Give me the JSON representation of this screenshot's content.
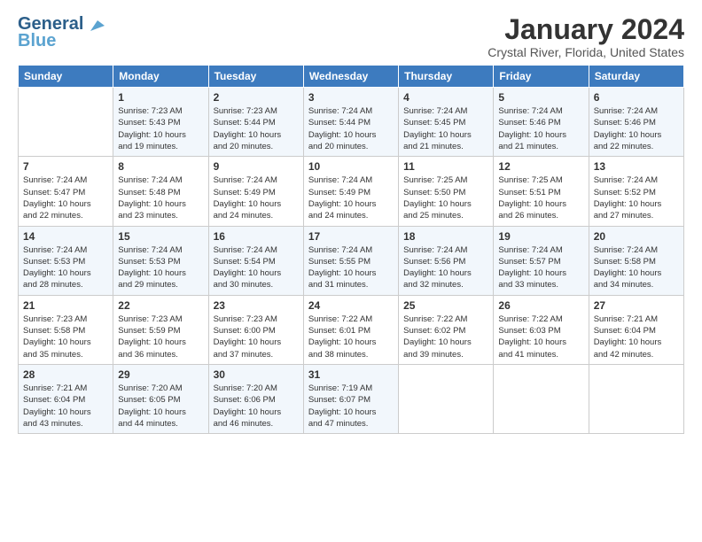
{
  "logo": {
    "line1": "General",
    "line2": "Blue"
  },
  "title": "January 2024",
  "location": "Crystal River, Florida, United States",
  "days_of_week": [
    "Sunday",
    "Monday",
    "Tuesday",
    "Wednesday",
    "Thursday",
    "Friday",
    "Saturday"
  ],
  "weeks": [
    [
      {
        "num": "",
        "detail": ""
      },
      {
        "num": "1",
        "detail": "Sunrise: 7:23 AM\nSunset: 5:43 PM\nDaylight: 10 hours\nand 19 minutes."
      },
      {
        "num": "2",
        "detail": "Sunrise: 7:23 AM\nSunset: 5:44 PM\nDaylight: 10 hours\nand 20 minutes."
      },
      {
        "num": "3",
        "detail": "Sunrise: 7:24 AM\nSunset: 5:44 PM\nDaylight: 10 hours\nand 20 minutes."
      },
      {
        "num": "4",
        "detail": "Sunrise: 7:24 AM\nSunset: 5:45 PM\nDaylight: 10 hours\nand 21 minutes."
      },
      {
        "num": "5",
        "detail": "Sunrise: 7:24 AM\nSunset: 5:46 PM\nDaylight: 10 hours\nand 21 minutes."
      },
      {
        "num": "6",
        "detail": "Sunrise: 7:24 AM\nSunset: 5:46 PM\nDaylight: 10 hours\nand 22 minutes."
      }
    ],
    [
      {
        "num": "7",
        "detail": "Sunrise: 7:24 AM\nSunset: 5:47 PM\nDaylight: 10 hours\nand 22 minutes."
      },
      {
        "num": "8",
        "detail": "Sunrise: 7:24 AM\nSunset: 5:48 PM\nDaylight: 10 hours\nand 23 minutes."
      },
      {
        "num": "9",
        "detail": "Sunrise: 7:24 AM\nSunset: 5:49 PM\nDaylight: 10 hours\nand 24 minutes."
      },
      {
        "num": "10",
        "detail": "Sunrise: 7:24 AM\nSunset: 5:49 PM\nDaylight: 10 hours\nand 24 minutes."
      },
      {
        "num": "11",
        "detail": "Sunrise: 7:25 AM\nSunset: 5:50 PM\nDaylight: 10 hours\nand 25 minutes."
      },
      {
        "num": "12",
        "detail": "Sunrise: 7:25 AM\nSunset: 5:51 PM\nDaylight: 10 hours\nand 26 minutes."
      },
      {
        "num": "13",
        "detail": "Sunrise: 7:24 AM\nSunset: 5:52 PM\nDaylight: 10 hours\nand 27 minutes."
      }
    ],
    [
      {
        "num": "14",
        "detail": "Sunrise: 7:24 AM\nSunset: 5:53 PM\nDaylight: 10 hours\nand 28 minutes."
      },
      {
        "num": "15",
        "detail": "Sunrise: 7:24 AM\nSunset: 5:53 PM\nDaylight: 10 hours\nand 29 minutes."
      },
      {
        "num": "16",
        "detail": "Sunrise: 7:24 AM\nSunset: 5:54 PM\nDaylight: 10 hours\nand 30 minutes."
      },
      {
        "num": "17",
        "detail": "Sunrise: 7:24 AM\nSunset: 5:55 PM\nDaylight: 10 hours\nand 31 minutes."
      },
      {
        "num": "18",
        "detail": "Sunrise: 7:24 AM\nSunset: 5:56 PM\nDaylight: 10 hours\nand 32 minutes."
      },
      {
        "num": "19",
        "detail": "Sunrise: 7:24 AM\nSunset: 5:57 PM\nDaylight: 10 hours\nand 33 minutes."
      },
      {
        "num": "20",
        "detail": "Sunrise: 7:24 AM\nSunset: 5:58 PM\nDaylight: 10 hours\nand 34 minutes."
      }
    ],
    [
      {
        "num": "21",
        "detail": "Sunrise: 7:23 AM\nSunset: 5:58 PM\nDaylight: 10 hours\nand 35 minutes."
      },
      {
        "num": "22",
        "detail": "Sunrise: 7:23 AM\nSunset: 5:59 PM\nDaylight: 10 hours\nand 36 minutes."
      },
      {
        "num": "23",
        "detail": "Sunrise: 7:23 AM\nSunset: 6:00 PM\nDaylight: 10 hours\nand 37 minutes."
      },
      {
        "num": "24",
        "detail": "Sunrise: 7:22 AM\nSunset: 6:01 PM\nDaylight: 10 hours\nand 38 minutes."
      },
      {
        "num": "25",
        "detail": "Sunrise: 7:22 AM\nSunset: 6:02 PM\nDaylight: 10 hours\nand 39 minutes."
      },
      {
        "num": "26",
        "detail": "Sunrise: 7:22 AM\nSunset: 6:03 PM\nDaylight: 10 hours\nand 41 minutes."
      },
      {
        "num": "27",
        "detail": "Sunrise: 7:21 AM\nSunset: 6:04 PM\nDaylight: 10 hours\nand 42 minutes."
      }
    ],
    [
      {
        "num": "28",
        "detail": "Sunrise: 7:21 AM\nSunset: 6:04 PM\nDaylight: 10 hours\nand 43 minutes."
      },
      {
        "num": "29",
        "detail": "Sunrise: 7:20 AM\nSunset: 6:05 PM\nDaylight: 10 hours\nand 44 minutes."
      },
      {
        "num": "30",
        "detail": "Sunrise: 7:20 AM\nSunset: 6:06 PM\nDaylight: 10 hours\nand 46 minutes."
      },
      {
        "num": "31",
        "detail": "Sunrise: 7:19 AM\nSunset: 6:07 PM\nDaylight: 10 hours\nand 47 minutes."
      },
      {
        "num": "",
        "detail": ""
      },
      {
        "num": "",
        "detail": ""
      },
      {
        "num": "",
        "detail": ""
      }
    ]
  ]
}
